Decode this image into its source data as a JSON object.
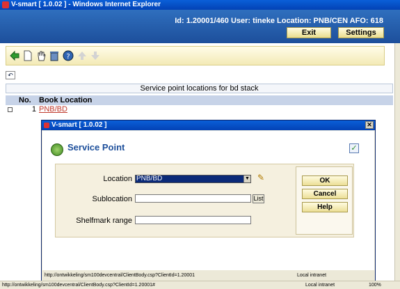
{
  "window": {
    "title": "V-smart [ 1.0.02 ] - Windows Internet Explorer"
  },
  "header": {
    "info": "Id: 1.20001/460   User: tineke   Location: PNB/CEN   AFO: 618",
    "exit_label": "Exit",
    "settings_label": "Settings"
  },
  "toolbar": {
    "icons": [
      "back-arrow-icon",
      "new-document-icon",
      "hand-icon",
      "trash-icon",
      "help-icon",
      "arrow-up-icon",
      "arrow-down-icon"
    ]
  },
  "section_title": "Service point locations for bd stack",
  "table": {
    "headers": {
      "no": "No.",
      "location": "Book Location"
    },
    "rows": [
      {
        "no": "1",
        "location": "PNB/BD"
      }
    ]
  },
  "dialog": {
    "title": "V-smart [ 1.0.02 ]",
    "close_label": "✕",
    "heading": "Service Point",
    "fields": {
      "location_label": "Location",
      "location_value": "PNB/BD",
      "sublocation_label": "Sublocation",
      "sublocation_value": "",
      "list_label": "List",
      "shelfmark_label": "Shelfmark range",
      "shelfmark_value": ""
    },
    "buttons": {
      "ok": "OK",
      "cancel": "Cancel",
      "help": "Help"
    },
    "status_url": "http://ontwikkeling/sm100devcentral/ClientBody.csp?ClientId=1.20001",
    "status_zone": "Local intranet"
  },
  "statusbar": {
    "url": "http://ontwikkeling/sm100devcentral/ClientBody.csp?ClientId=1.20001#",
    "zone": "Local intranet",
    "zoom": "100%"
  },
  "colors": {
    "accent": "#1d4f9b",
    "button": "#ecdf96",
    "link": "#c0392b"
  }
}
